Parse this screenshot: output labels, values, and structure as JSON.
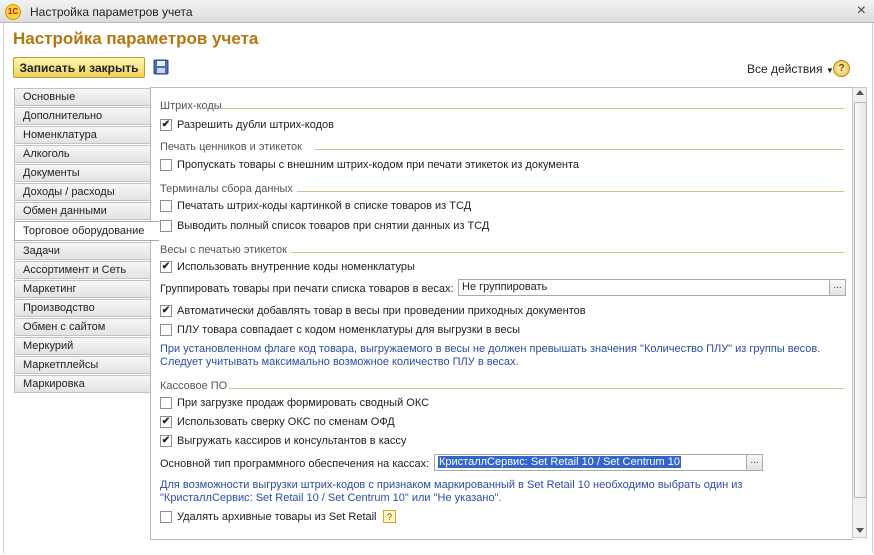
{
  "window": {
    "title": "Настройка параметров учета",
    "logo": "1С",
    "close_glyph": "×"
  },
  "form": {
    "title": "Настройка параметров учета"
  },
  "toolbar": {
    "save_label": "Записать и закрыть",
    "all_actions_label": "Все действия",
    "help_label": "?"
  },
  "sidebar": {
    "items": [
      {
        "label": "Основные",
        "active": false
      },
      {
        "label": "Дополнительно",
        "active": false
      },
      {
        "label": "Номенклатура",
        "active": false
      },
      {
        "label": "Алкоголь",
        "active": false
      },
      {
        "label": "Документы",
        "active": false
      },
      {
        "label": "Доходы / расходы",
        "active": false
      },
      {
        "label": "Обмен данными",
        "active": false
      },
      {
        "label": "Торговое оборудование",
        "active": true
      },
      {
        "label": "Задачи",
        "active": false
      },
      {
        "label": "Ассортимент и Сеть",
        "active": false
      },
      {
        "label": "Маркетинг",
        "active": false
      },
      {
        "label": "Производство",
        "active": false
      },
      {
        "label": "Обмен с сайтом",
        "active": false
      },
      {
        "label": "Меркурий",
        "active": false
      },
      {
        "label": "Маркетплейсы",
        "active": false
      },
      {
        "label": "Маркировка",
        "active": false
      }
    ]
  },
  "sections": {
    "barcodes": {
      "title": "Штрих-коды",
      "allow_duplicates": {
        "label": "Разрешить дубли штрих-кодов",
        "checked": true
      }
    },
    "price_tags": {
      "title": "Печать ценников и этикеток",
      "skip_external": {
        "label": "Пропускать товары с внешним штрих-кодом при печати этикеток из документа",
        "checked": false
      }
    },
    "tsd": {
      "title": "Терминалы сбора данных",
      "print_picture": {
        "label": "Печатать штрих-коды картинкой в списке товаров из ТСД",
        "checked": false
      },
      "full_list": {
        "label": "Выводить полный список товаров при снятии данных из ТСД",
        "checked": false
      }
    },
    "scales": {
      "title": "Весы с печатью этикеток",
      "internal_codes": {
        "label": "Использовать внутренние коды номенклатуры",
        "checked": true
      },
      "group_label": "Группировать товары при печати списка товаров в весах:",
      "group_value": "Не группировать",
      "auto_add": {
        "label": "Автоматически добавлять товар в весы при проведении приходных документов",
        "checked": true
      },
      "plu_match": {
        "label": "ПЛУ товара совпадает с кодом номенклатуры для выгрузки в весы",
        "checked": false
      },
      "note_line1": "При установленном флаге код товара, выгружаемого в весы не должен превышать значения \"Количество ПЛУ\" из группы весов.",
      "note_line2": "Следует учитывать максимально возможное количество ПЛУ в весах."
    },
    "pos": {
      "title": "Кассовое ПО",
      "summary_oks": {
        "label": "При загрузке продаж формировать сводный ОКС",
        "checked": false
      },
      "ofd_check": {
        "label": "Использовать сверку ОКС по сменам ОФД",
        "checked": true
      },
      "export_cashiers": {
        "label": "Выгружать кассиров и консультантов в кассу",
        "checked": true
      },
      "software_label": "Основной тип программного обеспечения на кассах:",
      "software_value": "КристаллСервис: Set Retail 10 / Set Centrum 10",
      "note_line1": "Для возможности выгрузки штрих-кодов с признаком маркированный в Set Retail 10 необходимо выбрать один из",
      "note_line2": "\"КристаллСервис: Set Retail 10 / Set Centrum 10\" или \"Не указано\".",
      "delete_archive": {
        "label": "Удалять архивные товары из Set Retail",
        "checked": false
      },
      "hint_label": "?"
    }
  },
  "colors": {
    "title_accent": "#b5750f",
    "note_blue": "#2a4da5",
    "save_button": "#f0d25a"
  }
}
